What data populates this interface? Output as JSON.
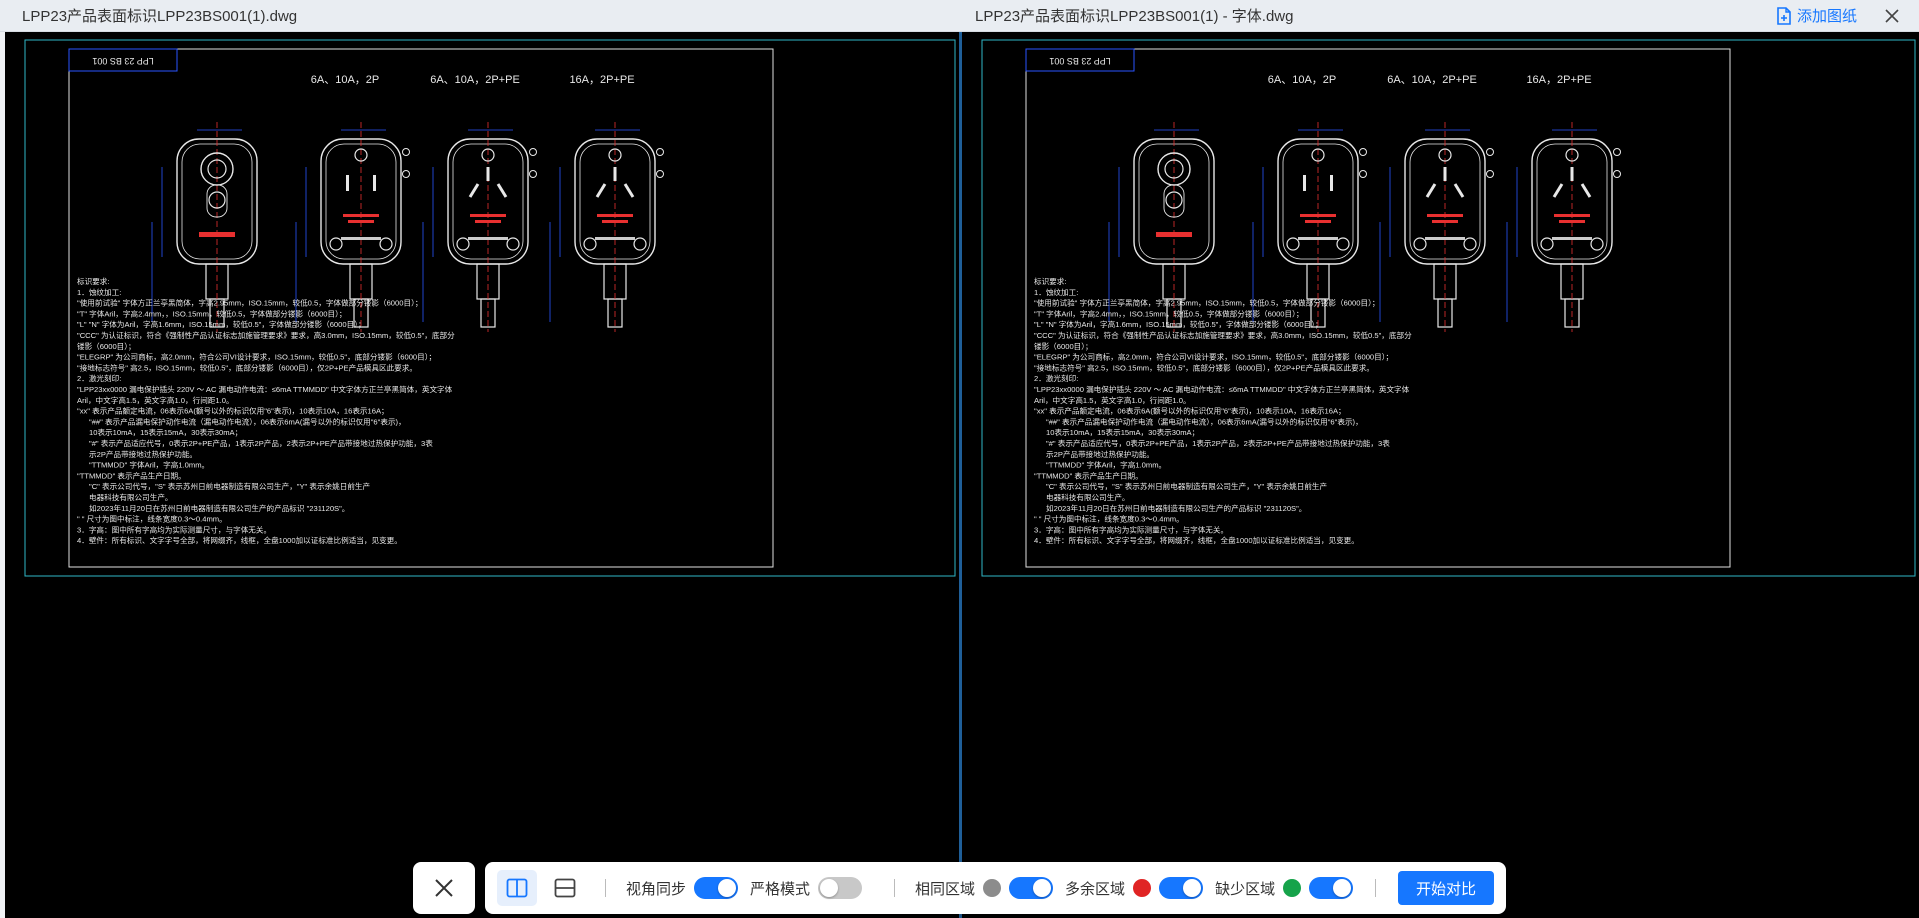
{
  "left_panel": {
    "title": "LPP23产品表面标识LPP23BS001(1).dwg"
  },
  "right_panel": {
    "title": "LPP23产品表面标识LPP23BS001(1) - 字体.dwg",
    "add_drawing_label": "添加图纸"
  },
  "drawing": {
    "stamp_text": "LPP 23 BS 001",
    "headings": [
      "6A、10A，2P",
      "6A、10A，2P+PE",
      "16A，2P+PE"
    ],
    "notes": [
      "标识要求:",
      "1．蚀纹加工:",
      "\"使用前试验\" 字体方正兰亭黑简体，字高2.95mm，ISO.15mm，较低0.5，字体做部分镂影（6000目）；",
      "\"T\" 字体Aril，字高2.4mm，，ISO.15mm，较低0.5，字体做部分镂影（6000目）；",
      "\"L\" \"N\" 字体为Aril，字高1.6mm，ISO.15mm，较低0.5\"，字体做部分镂影（6000目）；",
      "\"CCC\" 为认证标识，符合《强制性产品认证标志加施管理要求》要求，高3.0mm，ISO.15mm，较低0.5\"，底部分",
      "镂影（6000目）；",
      "\"ELEGRP\" 为公司商标，高2.0mm，符合公司VI设计要求，ISO.15mm，较低0.5\"，底部分镂影（6000目）；",
      "\"接地标志符号\" 高2.5，ISO.15mm，较低0.5\"，底部分镂影（6000目），仅2P+PE产品模具区此要求。",
      "2．激光刻印:",
      "\"LPP23xx0000 漏电保护插头 220V ～ AC 漏电动作电流：≤6mA TTMMDD\" 中文字体方正兰亭黑简体，英文字体",
      "Aril，中文字高1.5，英文字高1.0，行间距1.0。",
      "\"xx\" 表示产品额定电流，06表示6A(额号以外的标识仅用\"6\"表示)，10表示10A，16表示16A；",
      "\"##\" 表示产品漏电保护动作电流（漏电动作电流），06表示6mA(漏号以外的标识仅用\"6\"表示)，",
      "10表示10mA，15表示15mA，30表示30mA；",
      "\"#\" 表示产品适应代号，0表示2P+PE产品，1表示2P产品，2表示2P+PE产品带接地过热保护功能，3表",
      "示2P产品带接地过热保护功能。",
      "\"TTMMDD\" 字体Aril，字高1.0mm。",
      "\"TTMMDD\" 表示产品生产日期。",
      "\"C\" 表示公司代号，\"S\" 表示苏州日前电器制造有限公司生产，\"Y\" 表示余姚日前生产",
      "电器科技有限公司生产。",
      "如2023年11月20日在苏州日前电器制造有限公司生产的产品标识 \"231120S\"。",
      "\" \" 尺寸为图中标注，线条宽度0.3～0.4mm。",
      "3．字高：图中所有字高均为实际测量尺寸，与字体无关。",
      "4．壁件：所有标识、文字字号全部，将网缀齐，线框，全盘1000加以证标准比例适当，见变更。"
    ]
  },
  "toolbar": {
    "view_sync_label": "视角同步",
    "view_sync_on": true,
    "strict_mode_label": "严格模式",
    "strict_mode_on": false,
    "same_area_label": "相同区域",
    "same_area_color": "#8c8c8c",
    "same_area_on": true,
    "extra_area_label": "多余区域",
    "extra_area_color": "#e02424",
    "extra_area_on": true,
    "missing_area_label": "缺少区域",
    "missing_area_color": "#16a34a",
    "missing_area_on": true,
    "start_compare_label": "开始对比"
  }
}
